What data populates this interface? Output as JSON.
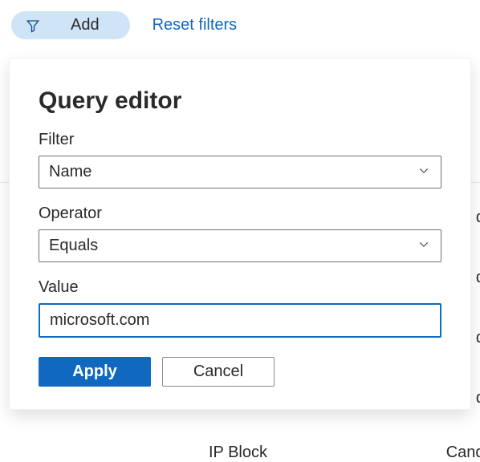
{
  "toolbar": {
    "add_label": "Add",
    "reset_label": "Reset filters"
  },
  "panel": {
    "title": "Query editor",
    "filter_label": "Filter",
    "filter_value": "Name",
    "operator_label": "Operator",
    "operator_value": "Equals",
    "value_label": "Value",
    "value_input": "microsoft.com",
    "apply_label": "Apply",
    "cancel_label": "Cancel"
  },
  "background": {
    "d1": "d",
    "d2": "d",
    "d3": "d",
    "d4": "d",
    "ipblock": "IP Block",
    "candi": "Candi"
  }
}
